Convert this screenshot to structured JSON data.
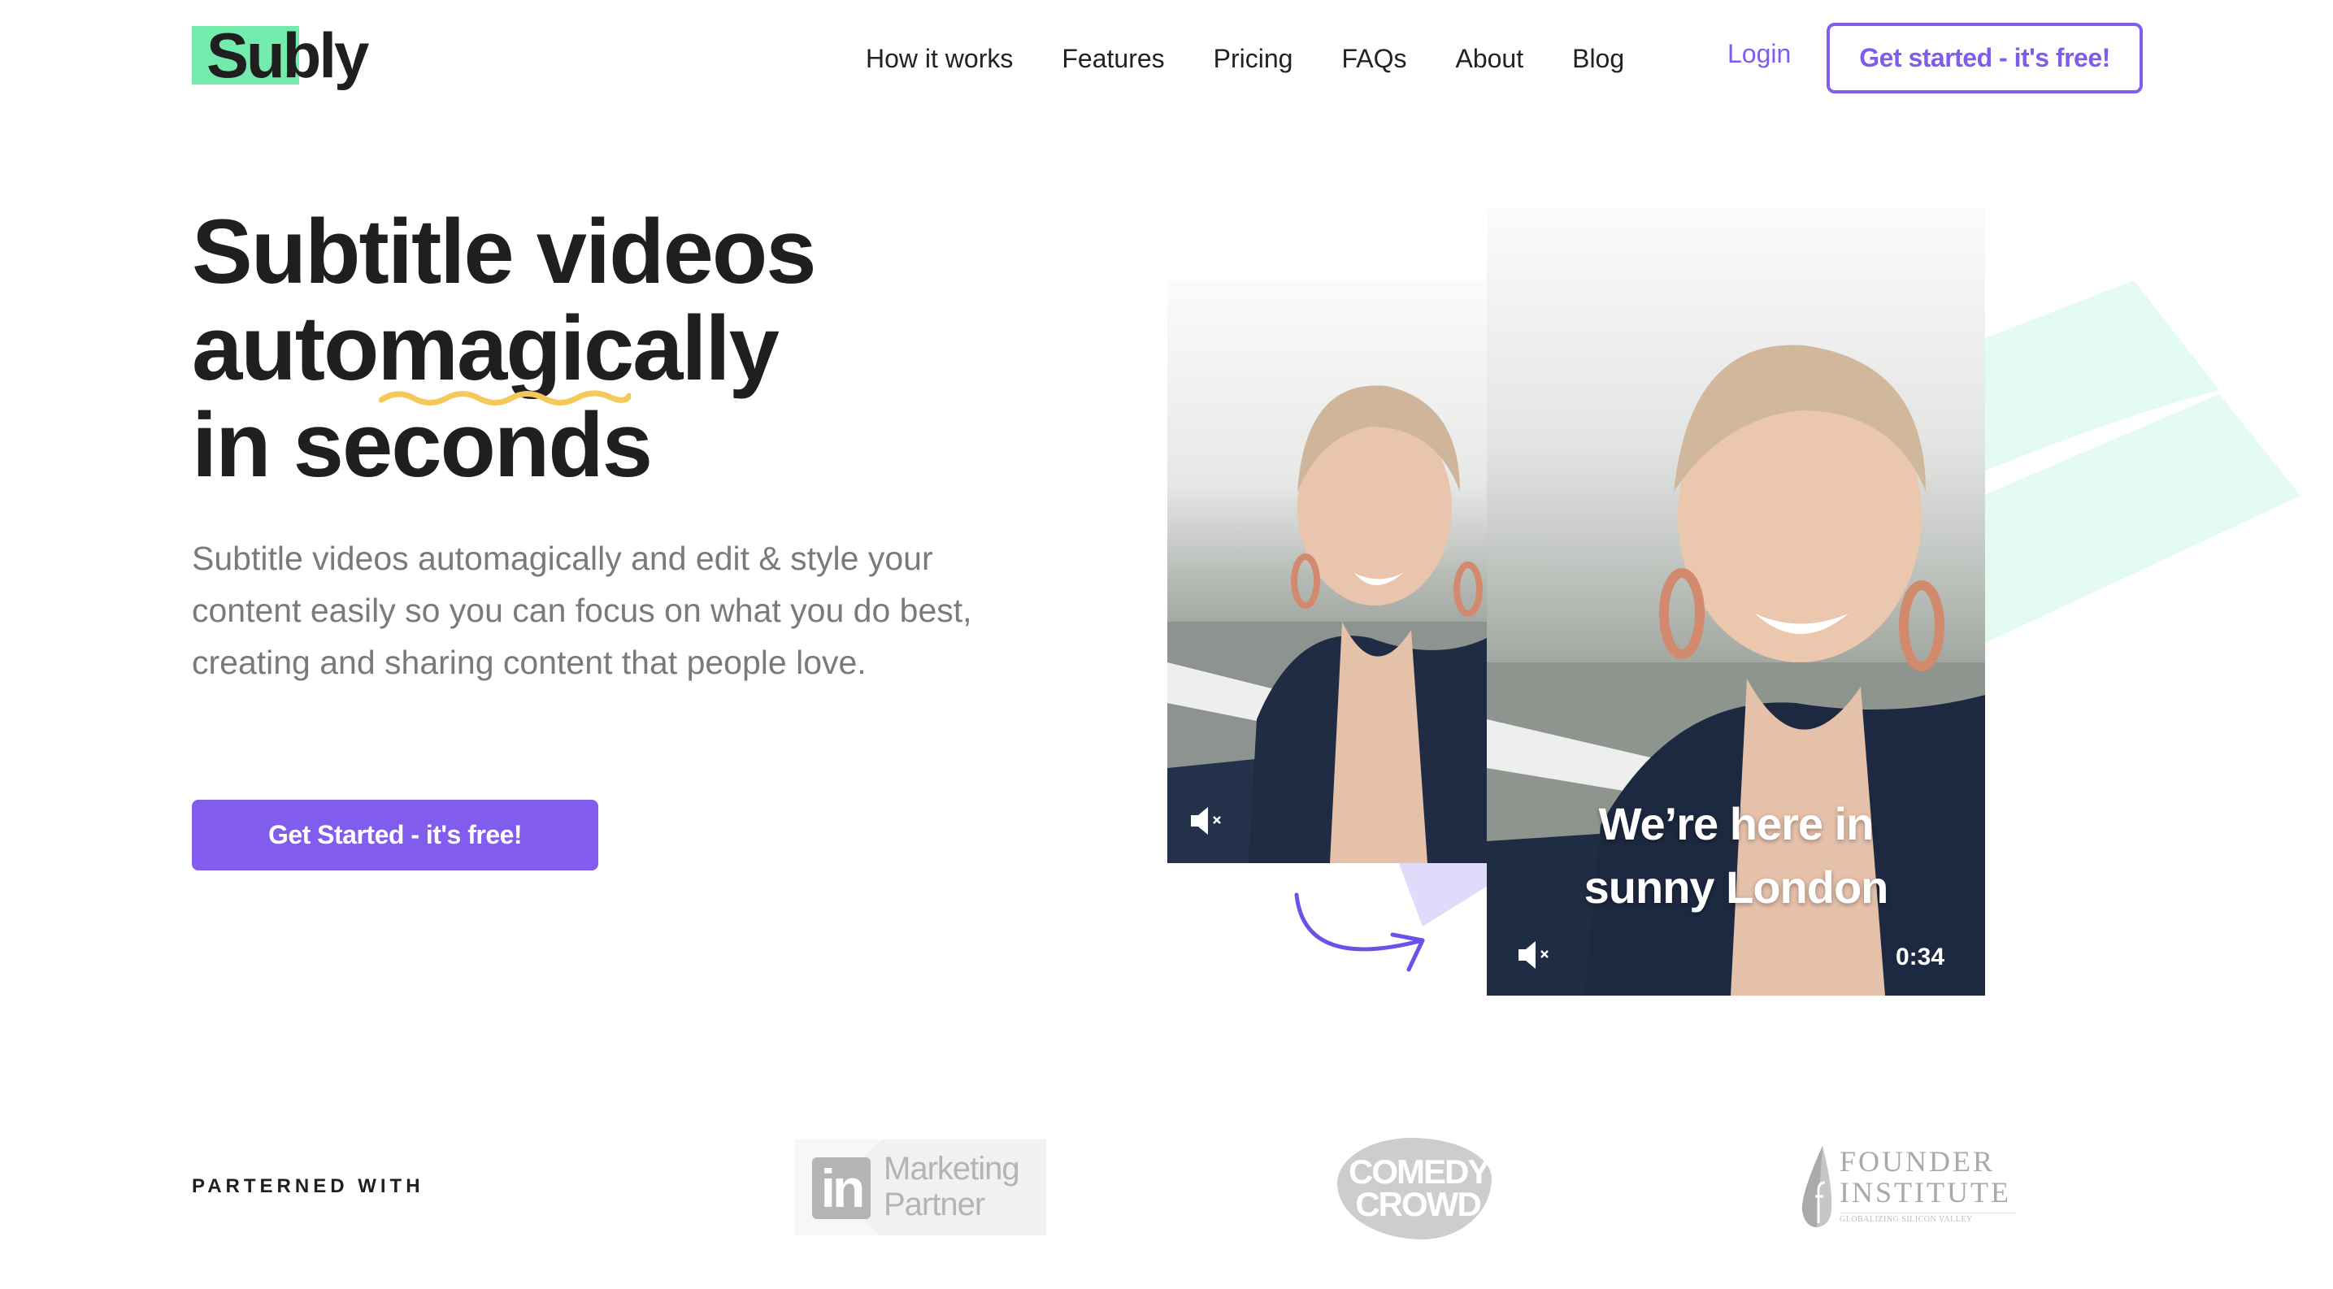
{
  "brand": {
    "logo_text": "Subly",
    "accent_color": "#825cec",
    "logo_highlight_color": "#73ebac",
    "highlight_underline_color": "#f5c85a"
  },
  "nav": {
    "items": [
      {
        "label": "How it works"
      },
      {
        "label": "Features"
      },
      {
        "label": "Pricing"
      },
      {
        "label": "FAQs"
      },
      {
        "label": "About"
      },
      {
        "label": "Blog"
      }
    ],
    "login_label": "Login",
    "cta_label": "Get started - it's free!"
  },
  "hero": {
    "headline_lines": [
      "Subtitle videos",
      "automagically",
      "in seconds"
    ],
    "highlighted_word": "magic",
    "subtext": "Subtitle videos automagically and edit & style your content easily so you can focus on what you do best, creating and sharing content that people love.",
    "cta_label": "Get Started - it's free!"
  },
  "demo": {
    "before_video": {
      "muted_icon": "volume-mute-icon"
    },
    "after_video": {
      "caption_lines": [
        "We’re here in",
        "sunny London"
      ],
      "timestamp": "0:34",
      "muted_icon": "volume-mute-icon"
    },
    "transform_icon": "curved-arrow-icon"
  },
  "partners": {
    "label": "PARTERNED WITH",
    "logos": [
      {
        "name": "LinkedIn Marketing Partner",
        "badge": "in",
        "lines": [
          "Marketing",
          "Partner"
        ]
      },
      {
        "name": "Comedy Crowd",
        "lines": [
          "COMEDY",
          "CROWD"
        ]
      },
      {
        "name": "Founder Institute",
        "lines": [
          "FOUNDER",
          "INSTITUTE"
        ],
        "tagline": "GLOBALIZING SILICON VALLEY"
      }
    ]
  }
}
